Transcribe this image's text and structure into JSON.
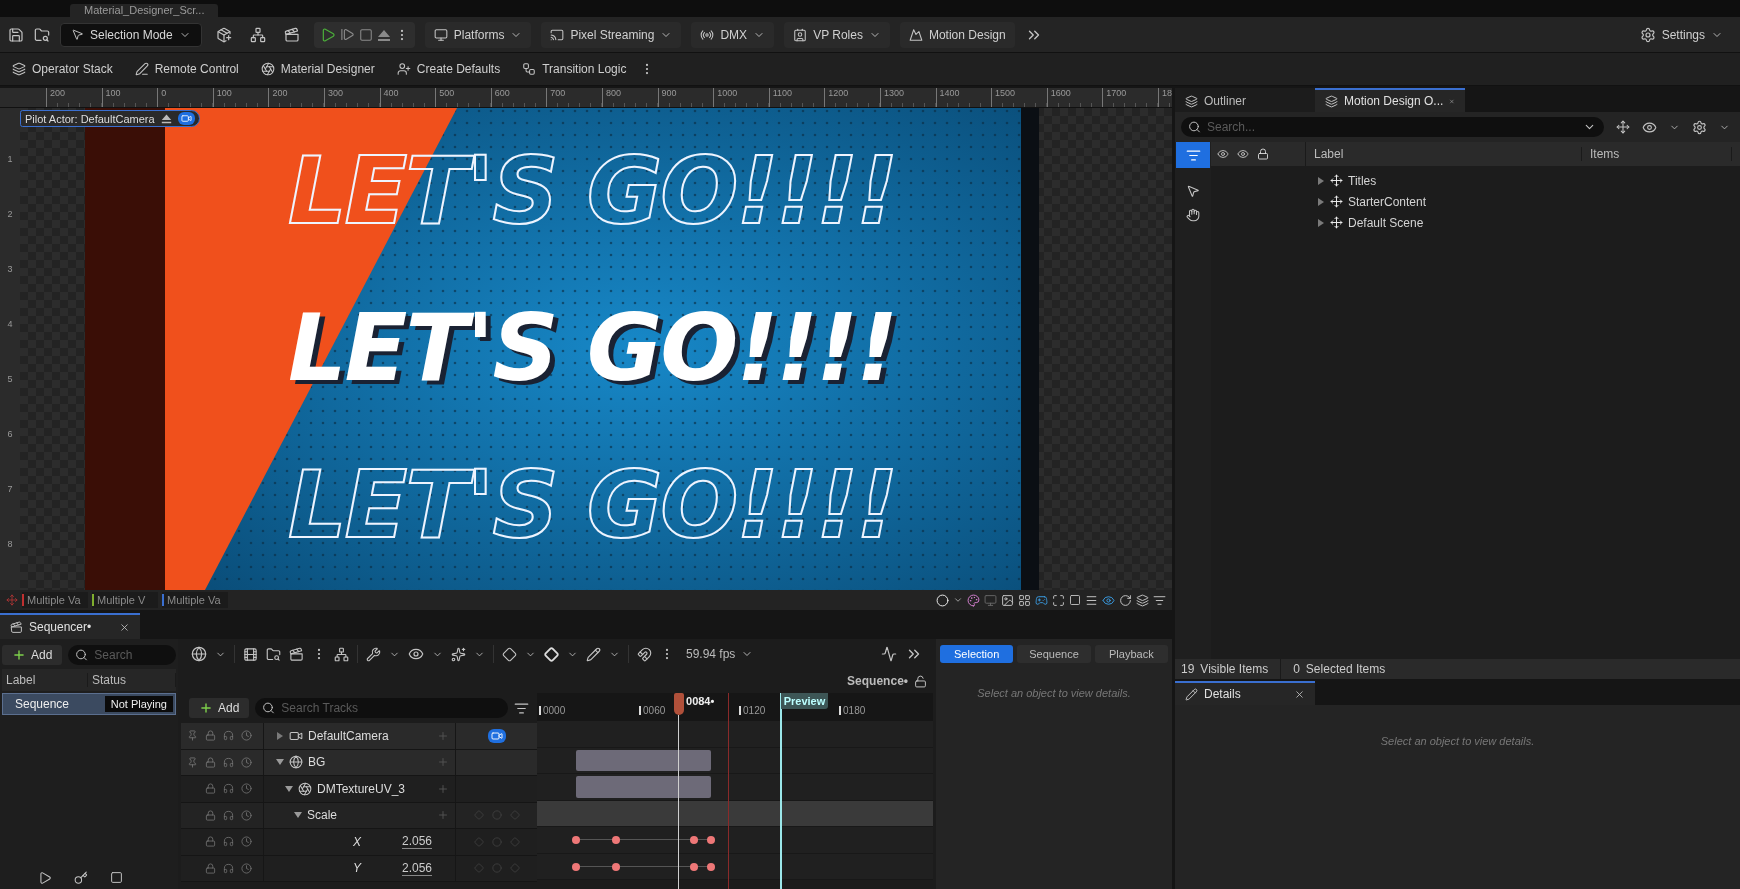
{
  "document_tab": {
    "label": "Material_Designer_Scr..."
  },
  "main_toolbar": {
    "mode": "Selection Mode",
    "menus": [
      {
        "label": "Platforms",
        "kind": "platforms"
      },
      {
        "label": "Pixel Streaming",
        "kind": "streaming"
      },
      {
        "label": "DMX",
        "kind": "dmx"
      },
      {
        "label": "VP Roles",
        "kind": "roles"
      }
    ],
    "motion_design": "Motion Design",
    "settings": "Settings"
  },
  "secondary_toolbar": [
    {
      "label": "Operator Stack",
      "kind": "stack"
    },
    {
      "label": "Remote Control",
      "kind": "remote"
    },
    {
      "label": "Material Designer",
      "kind": "material"
    },
    {
      "label": "Create Defaults",
      "kind": "defaults"
    },
    {
      "label": "Transition Logic",
      "kind": "transition"
    }
  ],
  "ruler": {
    "top_marks": [
      "200",
      "100",
      "0",
      "100",
      "200",
      "300",
      "400",
      "500",
      "600",
      "700",
      "800",
      "900",
      "1000",
      "1100",
      "1200",
      "1300",
      "1400",
      "1500",
      "1600",
      "1700",
      "18"
    ],
    "side_marks": [
      "1",
      "2",
      "3",
      "4",
      "5",
      "6",
      "7",
      "8"
    ]
  },
  "viewport": {
    "pilot_actor": "Pilot Actor: DefaultCamera",
    "headlines": [
      {
        "text": "LET'S GO!!!!",
        "kind": "outline"
      },
      {
        "text": "LET'S GO!!!!",
        "kind": "solid"
      },
      {
        "text": "LET'S GO!!!!",
        "kind": "outline"
      }
    ],
    "transform_fields": [
      {
        "value": "Multiple Va",
        "color": "#c03030"
      },
      {
        "value": "Multiple V",
        "color": "#7fae2e"
      },
      {
        "value": "Multiple Va",
        "color": "#3a6fd0"
      }
    ]
  },
  "sequencer": {
    "tab": "Sequencer•",
    "add": "Add",
    "search_placeholder": "Search",
    "columns": [
      "Label",
      "Status"
    ],
    "rows": [
      {
        "label": "Sequence",
        "status": "Not Playing",
        "selected": true
      }
    ],
    "fps": "59.94 fps",
    "sequence_name": "Sequence•",
    "track_add": "Add",
    "track_search_placeholder": "Search Tracks",
    "tracks": [
      {
        "label": "DefaultCamera",
        "kind": "camera",
        "expanded": false,
        "camera_cut": true
      },
      {
        "label": "BG",
        "kind": "actor",
        "expanded": true,
        "children": [
          {
            "label": "DMTextureUV_3",
            "kind": "material",
            "expanded": true,
            "children": [
              {
                "label": "Scale",
                "kind": "property",
                "expanded": true,
                "children": [
                  {
                    "label": "X",
                    "kind": "channel",
                    "value": "2.056"
                  },
                  {
                    "label": "Y",
                    "kind": "channel",
                    "value": "2.056"
                  }
                ]
              }
            ]
          }
        ]
      }
    ],
    "timeline": {
      "current_frame": "0084•",
      "preview": "Preview",
      "ticks": [
        "0000",
        "0060",
        "0120",
        "0180"
      ]
    },
    "details": {
      "tabs": [
        {
          "label": "Selection",
          "selected": true
        },
        {
          "label": "Sequence",
          "selected": false
        },
        {
          "label": "Playback",
          "selected": false
        }
      ],
      "message": "Select an object to view details."
    }
  },
  "outliner": {
    "tabs": [
      {
        "label": "Outliner",
        "selected": false,
        "closable": false
      },
      {
        "label": "Motion Design O...",
        "selected": true,
        "closable": true
      }
    ],
    "search_placeholder": "Search...",
    "filter_active": true,
    "columns": [
      "Label",
      "Items"
    ],
    "rows": [
      {
        "label": "Titles",
        "expanded": false
      },
      {
        "label": "StarterContent",
        "expanded": false
      },
      {
        "label": "Default Scene",
        "expanded": false
      }
    ],
    "visible_count": "19",
    "visible_label": "Visible Items",
    "selected_count": "0",
    "selected_label": "Selected Items"
  },
  "details": {
    "tab": "Details",
    "message": "Select an object to view details."
  }
}
